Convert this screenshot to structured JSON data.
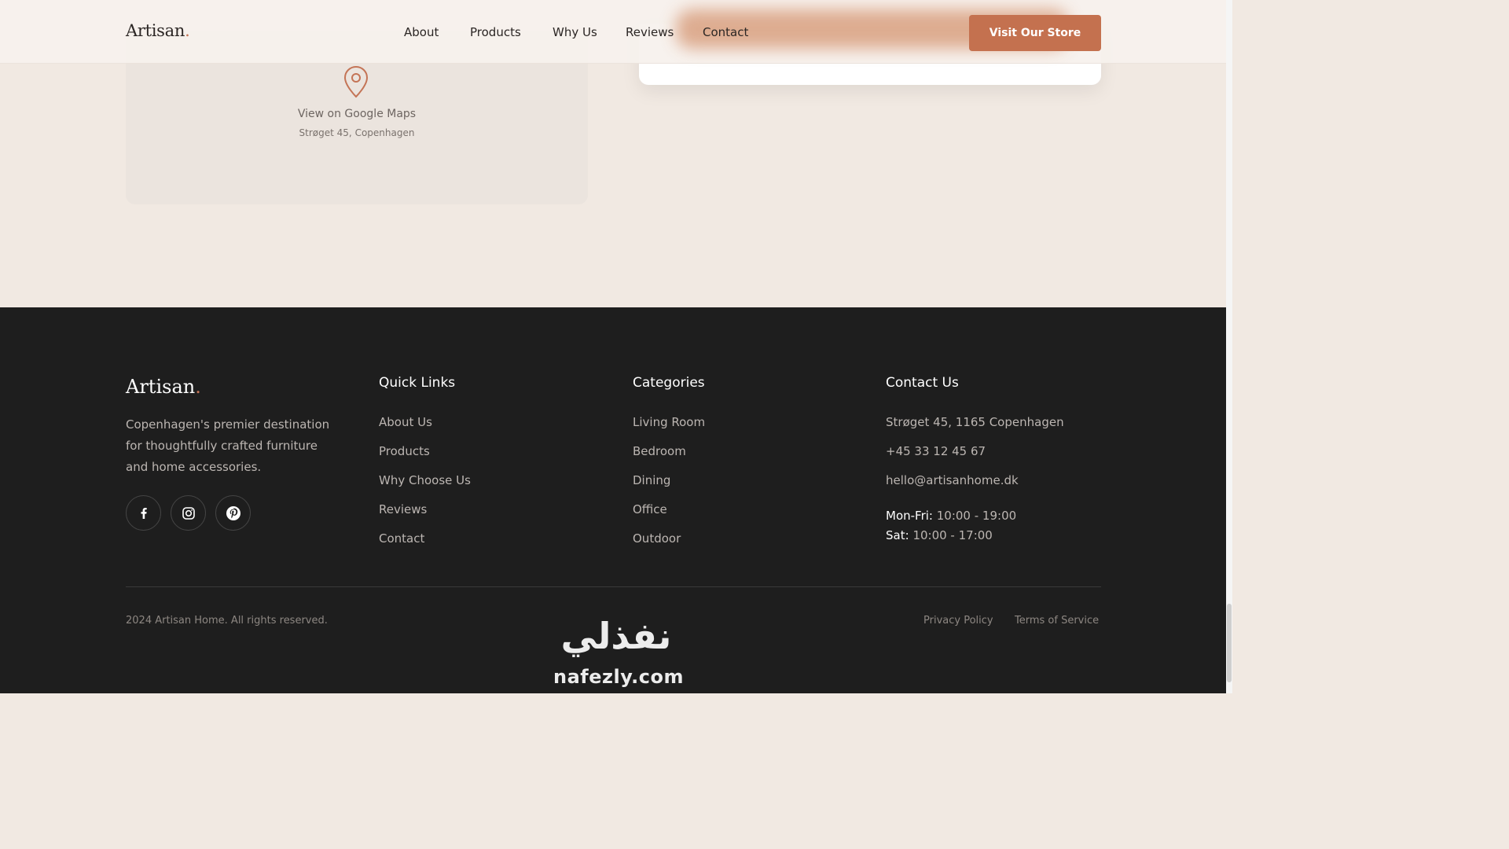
{
  "header": {
    "logo": "Artisan",
    "logo_dot": ".",
    "nav": [
      "About",
      "Products",
      "Why Us",
      "Reviews",
      "Contact"
    ],
    "cta": "Visit Our Store"
  },
  "map": {
    "link": "View on Google Maps",
    "address": "Strøget 45, Copenhagen"
  },
  "footer": {
    "logo": "Artisan",
    "logo_dot": ".",
    "description": "Copenhagen's premier destination for thoughtfully crafted furniture and home accessories.",
    "social": [
      "facebook-icon",
      "instagram-icon",
      "pinterest-icon"
    ],
    "quick_links": {
      "heading": "Quick Links",
      "items": [
        "About Us",
        "Products",
        "Why Choose Us",
        "Reviews",
        "Contact"
      ]
    },
    "categories": {
      "heading": "Categories",
      "items": [
        "Living Room",
        "Bedroom",
        "Dining",
        "Office",
        "Outdoor"
      ]
    },
    "contact": {
      "heading": "Contact Us",
      "address": "Strøget 45, 1165 Copenhagen",
      "phone": "+45 33 12 45 67",
      "email": "hello@artisanhome.dk",
      "hours": [
        {
          "label": "Mon-Fri:",
          "value": "10:00 - 19:00"
        },
        {
          "label": "Sat:",
          "value": "10:00 - 17:00"
        }
      ]
    },
    "copyright": "2024 Artisan Home. All rights reserved.",
    "legal": [
      "Privacy Policy",
      "Terms of Service"
    ]
  },
  "watermark": {
    "arabic": "نفذلي",
    "latin": "nafezly.com"
  },
  "colors": {
    "accent": "#c4714f",
    "footer_bg": "#1e1e1e",
    "page_bg": "#f1e9e2"
  }
}
